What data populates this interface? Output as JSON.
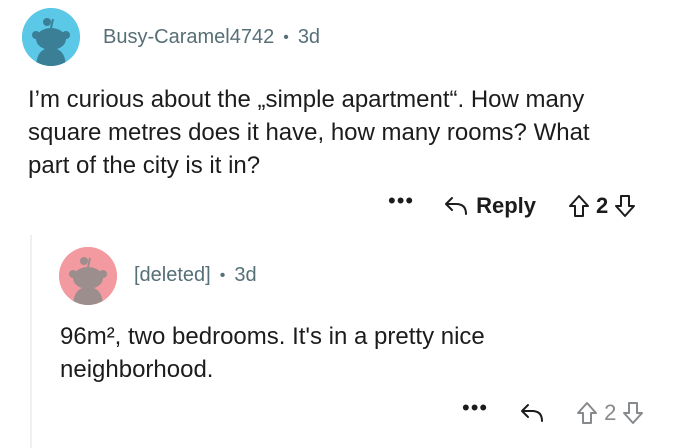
{
  "parent_comment": {
    "username": "Busy-Caramel4742",
    "separator": "•",
    "age": "3d",
    "body_lines": [
      "I’m curious about the „simple apartment“. How many",
      "square metres does it have, how many rooms? What",
      "part of the city is it in?"
    ],
    "more": "•••",
    "reply_label": "Reply",
    "votes": "2",
    "avatar_color": "#5bc8e8"
  },
  "reply_comment": {
    "username": "[deleted]",
    "separator": "•",
    "age": "3d",
    "body_lines": [
      "96m², two bedrooms. It's in a pretty nice",
      "neighborhood."
    ],
    "more": "•••",
    "votes": "2",
    "avatar_color": "#f29aa0"
  }
}
